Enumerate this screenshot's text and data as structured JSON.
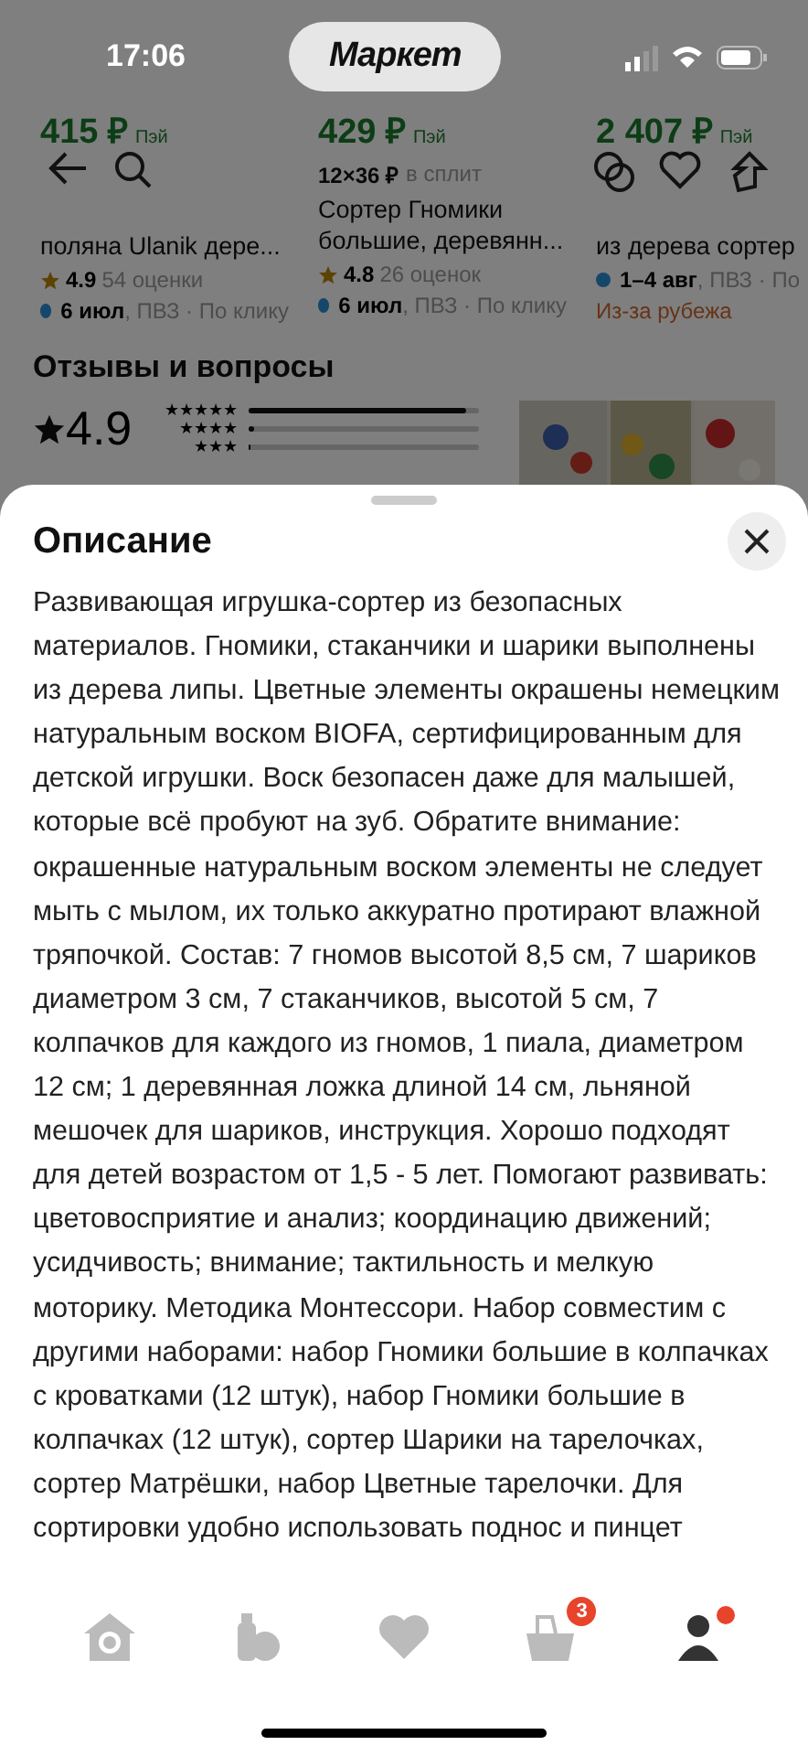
{
  "status_bar": {
    "time": "17:06",
    "app_badge": "Маркет"
  },
  "cards": [
    {
      "price": "415 ₽",
      "pay": "Пэй",
      "title": "поляна Ulanik дере...",
      "rating": "4.9",
      "reviews": "54 оценки",
      "delivery_date": "6 июл",
      "delivery_info": ", ПВЗ · По клику"
    },
    {
      "price": "429 ₽",
      "pay": "Пэй",
      "split": "12×36 ₽",
      "split_label": "в сплит",
      "title": "Сортер Гномики большие, деревянн...",
      "rating": "4.8",
      "reviews": "26 оценок",
      "delivery_date": "6 июл",
      "delivery_info": ", ПВЗ · По клику"
    },
    {
      "price": "2 407 ₽",
      "pay": "Пэй",
      "title": "из дерева сортер",
      "delivery_date": "1–4 авг",
      "delivery_info": ", ПВЗ · По",
      "note": "Из-за рубежа"
    }
  ],
  "reviews": {
    "title": "Отзывы и вопросы",
    "rating": "4.9",
    "bars": [
      {
        "stars": "★★★★★",
        "level": 0.94
      },
      {
        "stars": "★★★★",
        "level": 0.02
      },
      {
        "stars": "★★★",
        "level": 0.01
      }
    ]
  },
  "sheet": {
    "title": "Описание",
    "text": "Развивающая игрушка-сортер из безопасных материалов. Гномики, стаканчики и шарики выполнены из дерева липы. Цветные элементы окрашены немецким натуральным воском BIOFA, сертифицированным для детской игрушки. Воск безопасен даже для малышей, которые всё пробуют на зуб. Обратите внимание: окрашенные натуральным воском элементы не следует мыть с мылом, их только аккуратно протирают влажной тряпочкой. Состав: 7 гномов высотой 8,5 см, 7 шариков диаметром 3 см, 7 стаканчиков, высотой 5 см, 7 колпачков для каждого из гномов, 1 пиала, диаметром 12 см; 1 деревянная ложка длиной 14 см, льняной мешочек для шариков, инструкция. Хорошо подходят для детей возрастом от 1,5 - 5 лет. Помогают развивать: цветовосприятие и анализ; координацию движений; усидчивость; внимание; тактильность и мелкую моторику. Методика Монтессори. Набор совместим с другими наборами: набор Гномики большие в колпачках с кроватками (12 штук), набор Гномики большие в колпачках (12 штук), сортер Шарики на тарелочках, сортер Матрёшки, набор Цветные тарелочки. Для сортировки удобно использовать поднос и пинцет"
  },
  "nav": [
    {
      "kind": "home",
      "dot": false
    },
    {
      "kind": "catalog",
      "dot": false
    },
    {
      "kind": "favorites",
      "dot": false
    },
    {
      "kind": "cart",
      "badge": "3",
      "dot": false
    },
    {
      "kind": "profile",
      "dot": true
    }
  ]
}
